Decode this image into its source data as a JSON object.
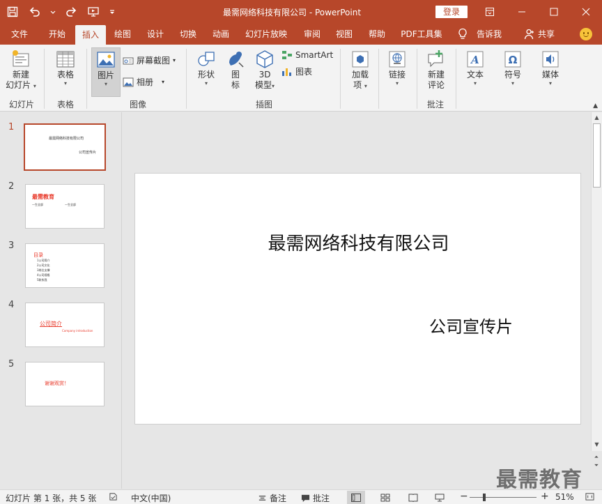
{
  "titlebar": {
    "title": "最需网络科技有限公司  -  PowerPoint",
    "signin": "登录"
  },
  "tabs": [
    "文件",
    "开始",
    "插入",
    "绘图",
    "设计",
    "切换",
    "动画",
    "幻灯片放映",
    "审阅",
    "视图",
    "帮助",
    "PDF工具集"
  ],
  "tell_me": "告诉我",
  "share": "共享",
  "ribbon": {
    "new_slide": [
      "新建",
      "幻灯片"
    ],
    "table": "表格",
    "picture": "图片",
    "screenshot": "屏幕截图",
    "album": "相册",
    "shapes": "形状",
    "icons": [
      "图",
      "标"
    ],
    "model3d": [
      "3D",
      "模型"
    ],
    "smartart": "SmartArt",
    "chart": "图表",
    "addins": [
      "加载",
      "项"
    ],
    "link": "链接",
    "new_comment": [
      "新建",
      "评论"
    ],
    "text": "文本",
    "symbols": "符号",
    "media": "媒体",
    "groups": {
      "slides": "幻灯片",
      "tables": "表格",
      "images": "图像",
      "illustrations": "插图",
      "comments": "批注"
    }
  },
  "slides": [
    {
      "num": "1",
      "line1": "最需网络科技有限公司",
      "line2": "公司宣传片"
    },
    {
      "num": "2",
      "line1": "最需教育",
      "line2": "一生全部",
      "line3": "一生全部"
    },
    {
      "num": "3",
      "line1": "目录",
      "items": [
        "1公司简介",
        "2公司文化",
        "3岗位支撑",
        "4公司规格",
        "5联系我"
      ]
    },
    {
      "num": "4",
      "line1": "公司简介",
      "line2": "Company introduction"
    },
    {
      "num": "5",
      "line1": "谢谢观赏！"
    }
  ],
  "current_slide": {
    "title": "最需网络科技有限公司",
    "subtitle": "公司宣传片"
  },
  "watermark": "最需教育",
  "status": {
    "slide_info": "幻灯片 第 1 张，共 5 张",
    "language": "中文(中国)",
    "notes": "备注",
    "comments": "批注",
    "zoom": "51%",
    "minus": "−",
    "plus": "+"
  }
}
